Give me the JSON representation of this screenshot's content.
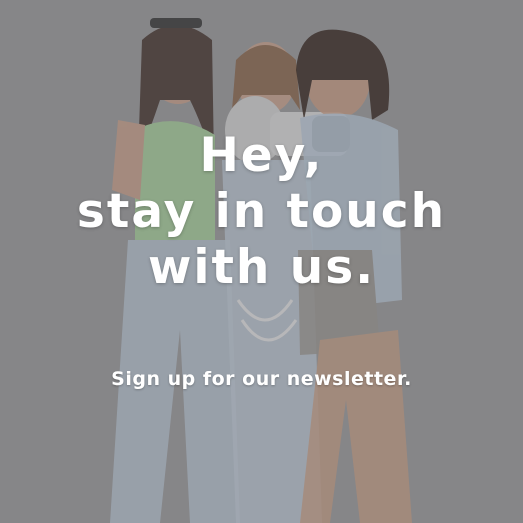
{
  "banner": {
    "headline_lines": [
      "Hey,",
      "stay in touch",
      "with us."
    ],
    "subheadline": "Sign up for our newsletter."
  },
  "colors": {
    "text": "#ffffff",
    "backdrop": "#8e8e90",
    "denim": "#b9c4d0",
    "top_green": "#9fc79a",
    "skin": "#c8a28c",
    "megaphone": "#d9d9d9"
  }
}
